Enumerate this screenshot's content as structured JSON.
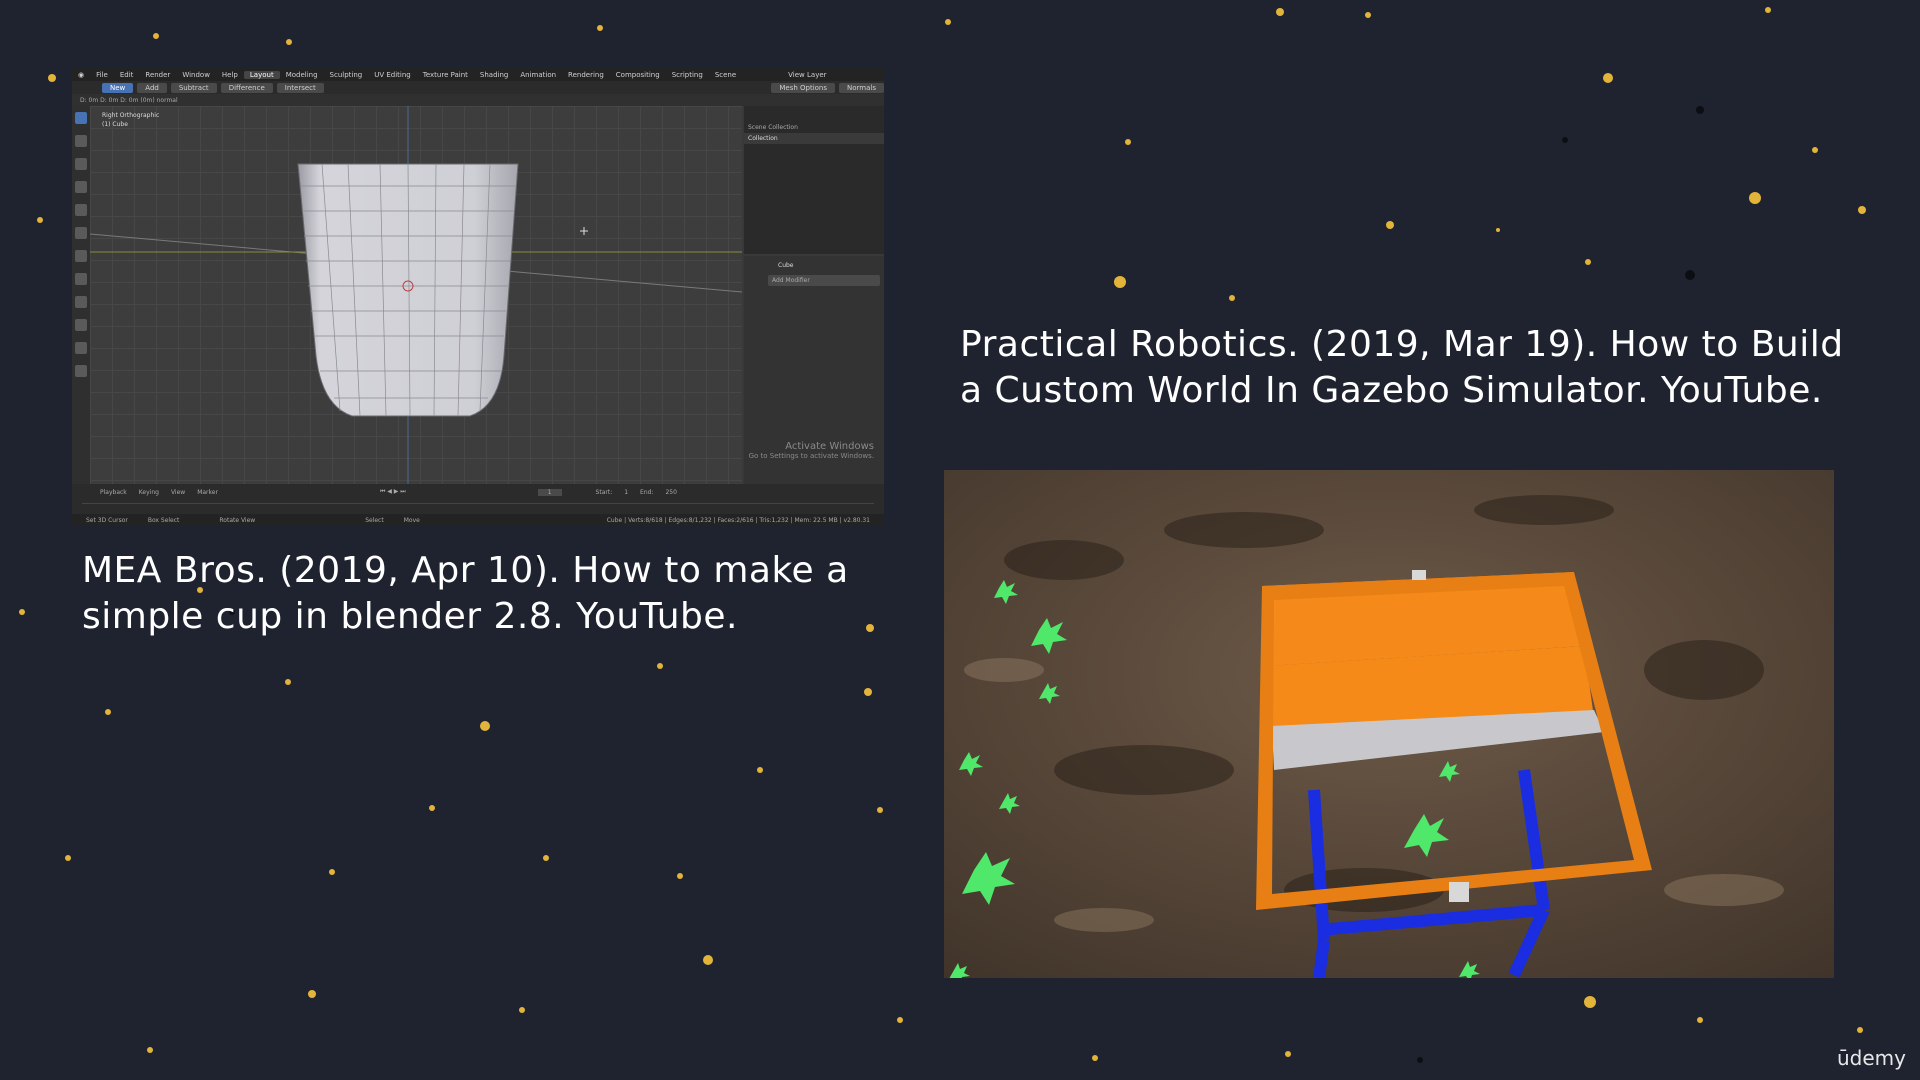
{
  "captions": {
    "left": "MEA Bros. (2019, Apr 10). How to make a simple cup in blender 2.8. YouTube.",
    "right": "Practical Robotics. (2019, Mar 19). How to Build a Custom World In Gazebo Simulator. YouTube."
  },
  "blender": {
    "menu": [
      "File",
      "Edit",
      "Render",
      "Window",
      "Help"
    ],
    "workspaces": [
      "Layout",
      "Modeling",
      "Sculpting",
      "UV Editing",
      "Texture Paint",
      "Shading",
      "Animation",
      "Rendering",
      "Compositing",
      "Scripting"
    ],
    "active_workspace": "Layout",
    "scene_label": "Scene",
    "view_layer_label": "View Layer",
    "tool_buttons": [
      "New",
      "Add",
      "Subtract",
      "Difference",
      "Intersect"
    ],
    "mesh_options": "Mesh Options",
    "normals": "Normals",
    "header_text": "D: 0m  D: 0m  D: 0m (0m) normal",
    "view_name": "Right Orthographic",
    "object_name": "(1) Cube",
    "outliner_title": "Scene Collection",
    "outliner_item": "Collection",
    "props_object": "Cube",
    "add_modifier": "Add Modifier",
    "timeline": [
      "Playback",
      "Keying",
      "View",
      "Marker"
    ],
    "current_frame": "1",
    "start_label": "Start:",
    "start_value": "1",
    "end_label": "End:",
    "end_value": "250",
    "watermark_title": "Activate Windows",
    "watermark_sub": "Go to Settings to activate Windows.",
    "status_left": [
      "Set 3D Cursor",
      "Box Select",
      "Rotate View",
      "Select",
      "Move"
    ],
    "status_right": "Cube | Verts:8/618 | Edges:8/1,232 | Faces:2/616 | Tris:1,232 | Mem: 22.5 MB | v2.80.31"
  },
  "brand": "ūdemy"
}
